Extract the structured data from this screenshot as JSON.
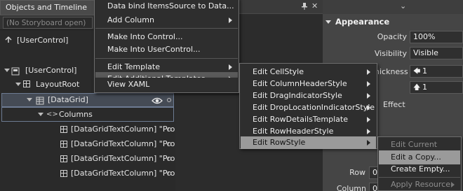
{
  "left_panel": {
    "tab_title": "Objects and Timeline",
    "storyboard": "(No Storyboard open)",
    "scope_label": "[UserControl]",
    "tree": [
      {
        "label": "[UserControl]"
      },
      {
        "label": "LayoutRoot"
      },
      {
        "label": "[DataGrid]"
      },
      {
        "label": "Columns"
      },
      {
        "label": "[DataGridTextColumn] \"Pro"
      },
      {
        "label": "[DataGridTextColumn] \"Pro"
      },
      {
        "label": "[DataGridTextColumn] \"Pro"
      },
      {
        "label": "[DataGridTextColumn] \"Pro"
      }
    ]
  },
  "context_menu": {
    "items": [
      {
        "label": "Data bind ItemsSource to Data..."
      },
      {
        "label": "Add Column"
      },
      {
        "label": "Make Into Control..."
      },
      {
        "label": "Make Into UserControl..."
      },
      {
        "label": "Edit Template"
      },
      {
        "label": "Edit Additional Templates"
      },
      {
        "label": "View XAML"
      }
    ]
  },
  "templates_submenu": {
    "items": [
      {
        "label": "Edit CellStyle"
      },
      {
        "label": "Edit ColumnHeaderStyle"
      },
      {
        "label": "Edit DragIndicatorStyle"
      },
      {
        "label": "Edit DropLocationIndicatorStyle"
      },
      {
        "label": "Edit RowDetailsTemplate"
      },
      {
        "label": "Edit RowHeaderStyle"
      },
      {
        "label": "Edit RowStyle"
      }
    ]
  },
  "rowstyle_submenu": {
    "items": [
      {
        "label": "Edit Current"
      },
      {
        "label": "Edit a Copy..."
      },
      {
        "label": "Create Empty..."
      },
      {
        "label": "Apply Resource"
      }
    ]
  },
  "properties": {
    "section": "Appearance",
    "opacity_label": "Opacity",
    "opacity_value": "100%",
    "visibility_label": "Visibility",
    "visibility_value": "Visible",
    "thickness_label": "hickness",
    "thickness_value_1": "1",
    "thickness_value_2": "1",
    "effect_label": "Effect",
    "row_label": "Row",
    "row_value": "0",
    "column_label": "Column",
    "column_value": "0"
  },
  "colors": {
    "menu_highlight": "#5a5a5a",
    "submenu_highlight": "#9a9a9a",
    "selection_border": "#6d7b92"
  }
}
